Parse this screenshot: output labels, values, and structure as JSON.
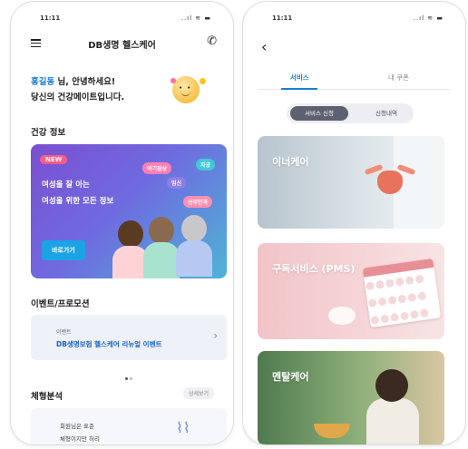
{
  "left_screen": {
    "status": {
      "time": "11:11",
      "icons": "..ıl ≋ ▬"
    },
    "header": {
      "title": "DB생명 헬스케어"
    },
    "greeting": {
      "name": "홍길동",
      "line1_rest": " 님, 안녕하세요!",
      "line2": "당신의 건강메이트입니다."
    },
    "health_section": {
      "title": "건강 정보",
      "banner": {
        "tag": "NEW",
        "line1": "여성을 잘 아는",
        "line2": "여성을 위한 모든 정보",
        "chips": [
          "여기장상",
          "자궁",
          "임신",
          "산부인과"
        ],
        "button": "바로가기"
      }
    },
    "event_section": {
      "title": "이벤트/프로모션",
      "card_small": "이벤트",
      "card_main": "DB생명보험 헬스케어 리뉴얼 이벤트"
    },
    "body_section": {
      "title": "체형분석",
      "detail_button": "상세보기",
      "text1": "회원님은 표준",
      "text2": "체형이지만 허리"
    }
  },
  "right_screen": {
    "status": {
      "time": "11:11",
      "icons": "..ıl ≋ ▬"
    },
    "tabs": [
      "서비스",
      "내 쿠폰"
    ],
    "segment": {
      "active": "서비스 신청",
      "inactive": "신청내역"
    },
    "cards": [
      {
        "label": "이너케어"
      },
      {
        "label": "구독서비스 (PMS)"
      },
      {
        "label": "멘탈케어"
      }
    ]
  }
}
